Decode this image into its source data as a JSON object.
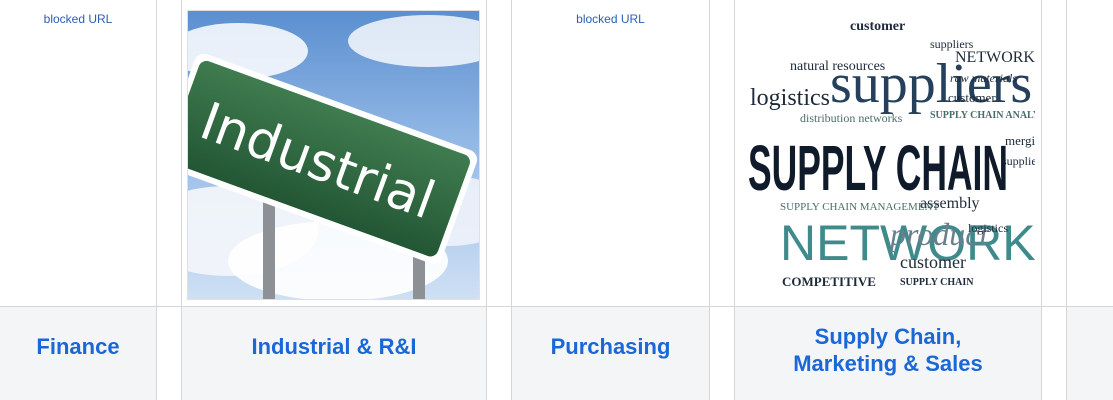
{
  "tiles": [
    {
      "id": "finance",
      "label": "Finance",
      "image_text": "blocked URL"
    },
    {
      "id": "industrial",
      "label": "Industrial & R&I",
      "image_text": "Industrial"
    },
    {
      "id": "purchasing",
      "label": "Purchasing",
      "image_text": "blocked URL"
    },
    {
      "id": "supply",
      "label_line1": "Supply Chain,",
      "label_line2": "Marketing & Sales",
      "words": [
        "customer",
        "suppliers",
        "NETWORK",
        "natural resources",
        "logistics",
        "raw materials",
        "customer",
        "SUPPLY CHAIN ANALYST",
        "distribution networks",
        "SUPPLY CHAIN",
        "merging",
        "suppliers",
        "assembly",
        "SUPPLY CHAIN MANAGEMENT",
        "NETWORK",
        "product",
        "customer",
        "COMPETITIVE",
        "SUPPLY CHAIN",
        "logistics"
      ]
    }
  ],
  "colors": {
    "link": "#1a67d6",
    "sign_green": "#2f6a3e",
    "border": "#d6d6d6"
  }
}
